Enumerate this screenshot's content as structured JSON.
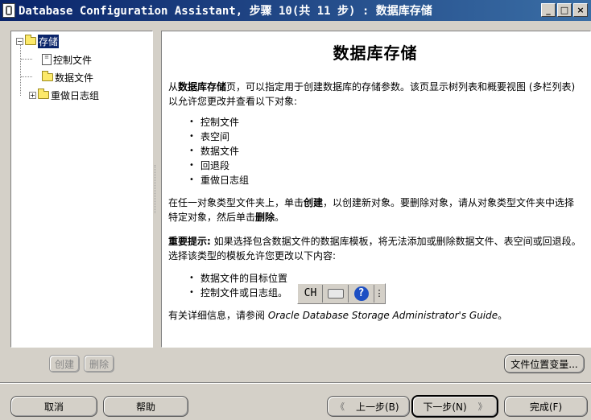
{
  "window": {
    "title": "Database Configuration Assistant, 步骤 10(共 11 步) : 数据库存储",
    "minimize_label": "_",
    "maximize_label": "□",
    "close_label": "×"
  },
  "tree": {
    "root_expander": "−",
    "root_label": "存储",
    "items": [
      {
        "label": "控制文件",
        "icon": "document-icon",
        "doc_text": "≡"
      },
      {
        "label": "数据文件",
        "icon": "folder-icon"
      },
      {
        "label": "重做日志组",
        "icon": "folder-icon",
        "expander": "+"
      }
    ]
  },
  "content": {
    "heading": "数据库存储",
    "intro_prefix": "从",
    "intro_bold": "数据库存储",
    "intro_rest": "页，可以指定用于创建数据库的存储参数。该页显示树列表和概要视图 (多栏列表) 以允许您更改并查看以下对象:",
    "objects": [
      "控制文件",
      "表空间",
      "数据文件",
      "回退段",
      "重做日志组"
    ],
    "create_para_1": "在任一对象类型文件夹上，单击",
    "create_para_bold1": "创建",
    "create_para_2": "，以创建新对象。要删除对象，请从对象类型文件夹中选择特定对象，然后单击",
    "create_para_bold2": "删除",
    "create_para_3": "。",
    "note_bold": "重要提示:",
    "note_text": " 如果选择包含数据文件的数据库模板，将无法添加或删除数据文件、表空间或回退段。选择该类型的模板允许您更改以下内容:",
    "template_items": [
      "数据文件的目标位置",
      "控制文件或日志组。"
    ],
    "more_info_prefix": "有关详细信息，请参阅 ",
    "more_info_guide": "Oracle Database Storage Administrator's Guide",
    "more_info_suffix": "。"
  },
  "ime": {
    "mode_label": "CH",
    "help_label": "?",
    "menu_label": "⋮"
  },
  "buttons": {
    "create": "创建",
    "delete": "删除",
    "file_location_vars": "文件位置变量...",
    "cancel": "取消",
    "help": "帮助",
    "back_arrow": "《",
    "back": "上一步(B)",
    "next": "下一步(N)",
    "next_arrow": "》",
    "finish": "完成(F)"
  },
  "colors": {
    "titlebar_start": "#0a246a",
    "titlebar_end": "#3a6ea5",
    "window_bg": "#d4d0c8",
    "selection": "#0a246a"
  }
}
